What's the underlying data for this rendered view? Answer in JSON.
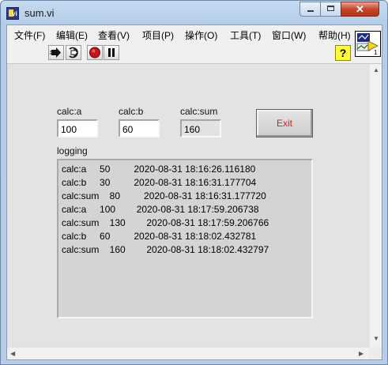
{
  "window": {
    "title": "sum.vi",
    "close_glyph": "✕"
  },
  "menu": [
    "文件(F)",
    "编辑(E)",
    "查看(V)",
    "项目(P)",
    "操作(O)",
    "工具(T)",
    "窗口(W)",
    "帮助(H)"
  ],
  "toolbar": {
    "help_glyph": "?",
    "icons": [
      "run-arrow-icon",
      "run-continuously-icon",
      "abort-icon",
      "pause-icon"
    ],
    "vi_icon_label": "1"
  },
  "controls": {
    "a": {
      "label": "calc:a",
      "value": "100"
    },
    "b": {
      "label": "calc:b",
      "value": "60"
    },
    "sum": {
      "label": "calc:sum",
      "value": "160"
    }
  },
  "exit_button": {
    "label": "Exit",
    "color": "#e01818"
  },
  "logging": {
    "label": "logging",
    "lines": [
      "calc:a     50         2020-08-31 18:16:26.116180",
      "calc:b     30         2020-08-31 18:16:31.177704",
      "calc:sum    80         2020-08-31 18:16:31.177720",
      "calc:a     100        2020-08-31 18:17:59.206738",
      "calc:sum    130        2020-08-31 18:17:59.206766",
      "calc:b     60         2020-08-31 18:18:02.432781",
      "calc:sum    160        2020-08-31 18:18:02.432797"
    ]
  }
}
